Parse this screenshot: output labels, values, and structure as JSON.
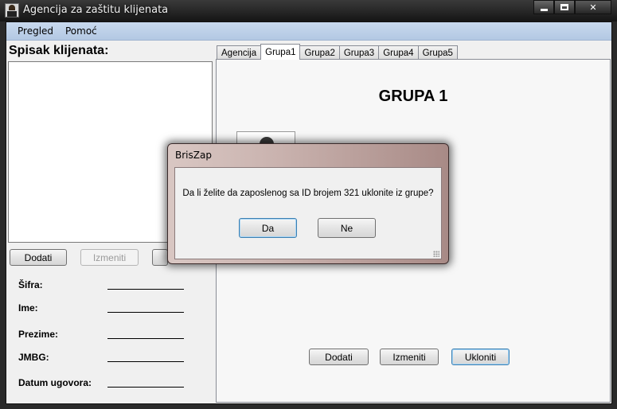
{
  "window": {
    "title": "Agencija za zaštitu klijenata"
  },
  "menu": {
    "items": [
      "Pregled",
      "Pomoć"
    ]
  },
  "left": {
    "title": "Spisak klijenata:",
    "buttons": {
      "add": "Dodati",
      "edit": "Izmeniti"
    },
    "fields": [
      "Šifra:",
      "Ime:",
      "Prezime:",
      "JMBG:",
      "Datum ugovora:"
    ]
  },
  "tabs": [
    "Agencija",
    "Grupa1",
    "Grupa2",
    "Grupa3",
    "Grupa4",
    "Grupa5"
  ],
  "active_tab": "Grupa1",
  "group_panel": {
    "title": "GRUPA 1",
    "buttons": {
      "add": "Dodati",
      "edit": "Izmeniti",
      "remove": "Ukloniti"
    }
  },
  "dialog": {
    "title": "BrisZap",
    "message": "Da li želite da zaposlenog sa ID brojem 321 uklonite iz grupe?",
    "yes": "Da",
    "no": "Ne"
  }
}
